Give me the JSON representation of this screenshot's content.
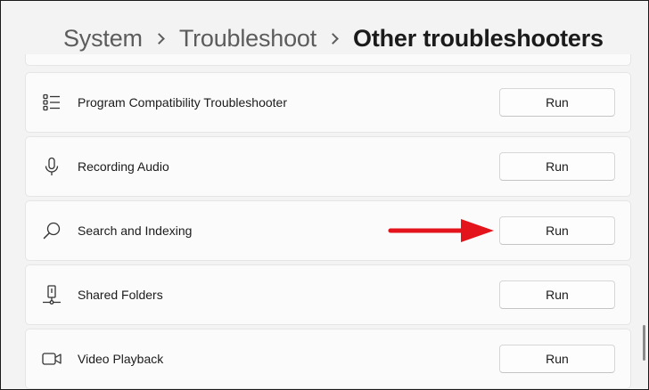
{
  "breadcrumb": {
    "items": [
      "System",
      "Troubleshoot"
    ],
    "current": "Other troubleshooters"
  },
  "troubleshooters": [
    {
      "label": "Program Compatibility Troubleshooter",
      "icon": "list-icon",
      "button": "Run"
    },
    {
      "label": "Recording Audio",
      "icon": "microphone-icon",
      "button": "Run"
    },
    {
      "label": "Search and Indexing",
      "icon": "search-icon",
      "button": "Run"
    },
    {
      "label": "Shared Folders",
      "icon": "shared-folder-icon",
      "button": "Run"
    },
    {
      "label": "Video Playback",
      "icon": "video-camera-icon",
      "button": "Run"
    }
  ],
  "colors": {
    "background": "#f3f3f3",
    "card": "#fbfbfb",
    "annotation_arrow": "#e3141b"
  }
}
